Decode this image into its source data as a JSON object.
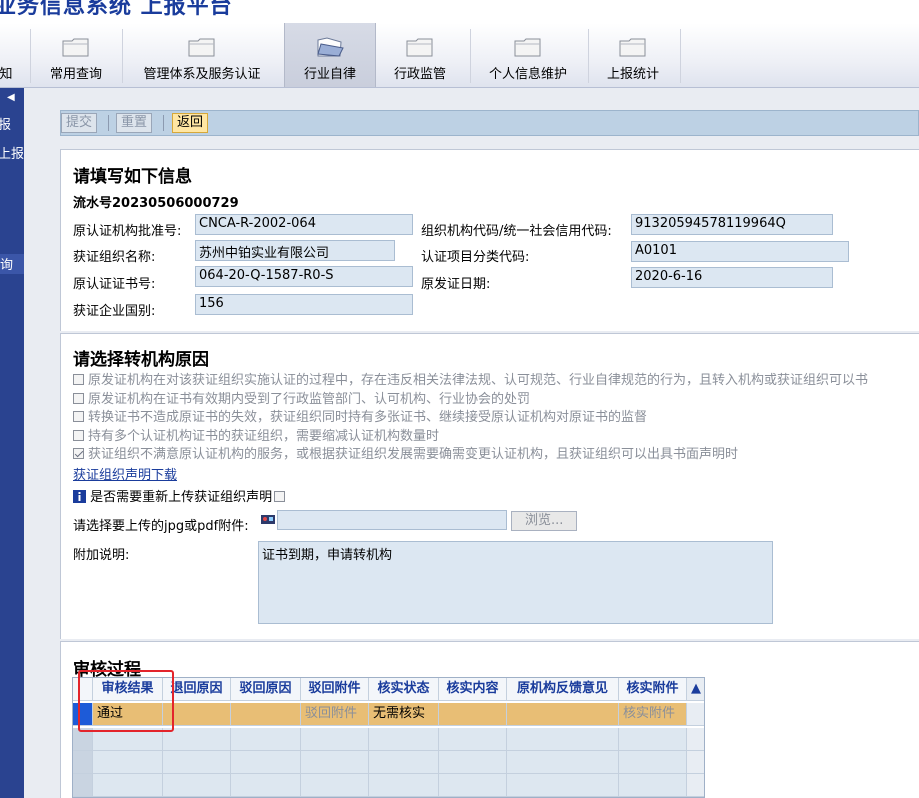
{
  "app": {
    "title": "业务信息系统  上报平台"
  },
  "nav": {
    "items": [
      {
        "label": "知"
      },
      {
        "label": "常用查询"
      },
      {
        "label": "管理体系及服务认证"
      },
      {
        "label": "行业自律"
      },
      {
        "label": "行政监管"
      },
      {
        "label": "个人信息维护"
      },
      {
        "label": "上报统计"
      }
    ]
  },
  "sidebar": {
    "items": [
      {
        "label": "报"
      },
      {
        "label": "上报"
      },
      {
        "label": "询"
      }
    ]
  },
  "toolbar": {
    "submit": "提交",
    "reset": "重置",
    "back": "返回"
  },
  "info": {
    "heading": "请填写如下信息",
    "serial": "流水号20230506000729",
    "fields": {
      "approval_no_label": "原认证机构批准号:",
      "approval_no": "CNCA-R-2002-064",
      "org_code_label": "组织机构代码/统一社会信用代码:",
      "org_code": "91320594578119964Q",
      "org_name_label": "获证组织名称:",
      "org_name": "苏州中铂实业有限公司",
      "category_label": "认证项目分类代码:",
      "category": "A0101",
      "cert_no_label": "原认证证书号:",
      "cert_no": "064-20-Q-1587-R0-S",
      "issue_date_label": "原发证日期:",
      "issue_date": "2020-6-16",
      "country_label": "获证企业国别:",
      "country": "156"
    }
  },
  "reasons": {
    "heading": "请选择转机构原因",
    "options": [
      {
        "text": "原发证机构在对该获证组织实施认证的过程中，存在违反相关法律法规、认可规范、行业自律规范的行为，且转入机构或获证组织可以书"
      },
      {
        "text": "原发证机构在证书有效期内受到了行政监管部门、认可机构、行业协会的处罚"
      },
      {
        "text": "转换证书不造成原证书的失效，获证组织同时持有多张证书、继续接受原认证机构对原证书的监督"
      },
      {
        "text": "持有多个认证机构证书的获证组织，需要缩减认证机构数量时"
      },
      {
        "text": "获证组织不满意原认证机构的服务，或根据获证组织发展需要确需变更认证机构，且获证组织可以出具书面声明时"
      }
    ],
    "download_link": "获证组织声明下载",
    "reupload_label": "是否需要重新上传获证组织声明",
    "upload_label": "请选择要上传的jpg或pdf附件:",
    "browse_button": "浏览...",
    "note_label": "附加说明:",
    "note_value": "证书到期，申请转机构"
  },
  "review": {
    "heading": "审核过程",
    "columns": [
      "审核结果",
      "退回原因",
      "驳回原因",
      "驳回附件",
      "核实状态",
      "核实内容",
      "原机构反馈意见",
      "核实附件"
    ],
    "rows": [
      {
        "result": "通过",
        "return_reason": "",
        "reject_reason": "",
        "reject_attachment": "驳回附件",
        "verify_status": "无需核实",
        "verify_content": "",
        "feedback": "",
        "verify_attachment": "核实附件"
      }
    ]
  }
}
